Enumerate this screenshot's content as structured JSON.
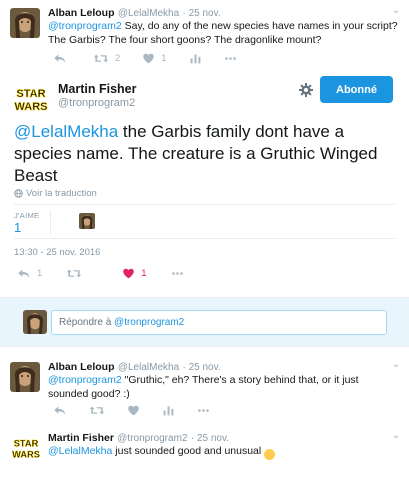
{
  "colors": {
    "accent": "#1b95e0",
    "like": "#e0245e",
    "muted": "#8899a6",
    "divider": "#e6ecf0"
  },
  "tweet1": {
    "name": "Alban Leloup",
    "handle": "@LelalMekha",
    "time": "· 25 nov.",
    "mention": "@tronprogram2",
    "text": " Say, do any of the new species have names in your script? The Garbis? The four short goons? The dragonlike mount?",
    "reply_count": "",
    "retweet_count": "2",
    "like_count": "1",
    "analytics_label": ""
  },
  "main": {
    "name": "Martin Fisher",
    "handle": "@tronprogram2",
    "follow_label": "Abonné",
    "mention": "@LelalMekha",
    "text": " the Garbis family dont have a species name. The creature is a Gruthic Winged Beast",
    "translation": "Voir la traduction",
    "likes_label": "J'AIME",
    "likes_count": "1",
    "timestamp": "13:30 - 25 nov. 2016",
    "reply_count": "1",
    "retweet_count": "",
    "like_count": "1"
  },
  "reply_box": {
    "prefix": "Répondre à ",
    "mention": "@tronprogram2"
  },
  "tweet3": {
    "name": "Alban Leloup",
    "handle": "@LelalMekha",
    "time": "· 25 nov.",
    "mention": "@tronprogram2",
    "text": " \"Gruthic,\" eh? There's a story behind that, or it just sounded good? :)"
  },
  "tweet4": {
    "name": "Martin Fisher",
    "handle": "@tronprogram2",
    "time": "· 25 nov.",
    "mention": "@LelalMekha",
    "text": " just sounded good and unusual ",
    "emoji": "😀"
  },
  "icons": {
    "reply": "reply-icon",
    "retweet": "retweet-icon",
    "like": "heart-icon",
    "analytics": "analytics-icon",
    "more": "more-dots-icon",
    "gear": "gear-icon",
    "chevron": "chevron-down-icon",
    "globe": "globe-icon"
  },
  "logo_text": "STAR WARS"
}
